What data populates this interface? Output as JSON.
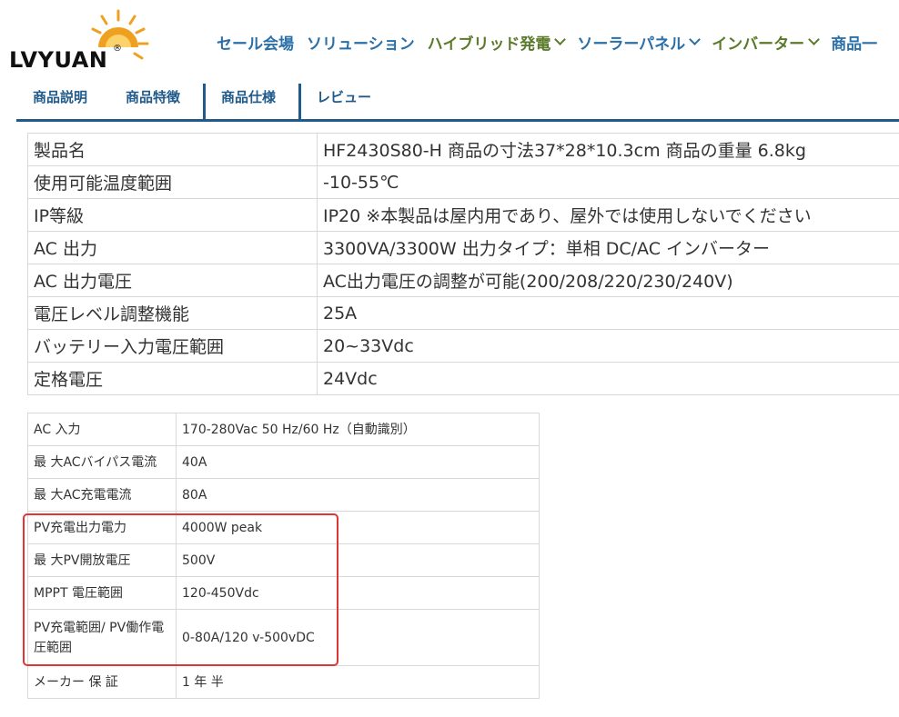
{
  "brand": {
    "name": "LVYUAN",
    "reg_mark": "®"
  },
  "nav": [
    {
      "label": "セール会場",
      "color": "#2a6fa8",
      "dropdown": false
    },
    {
      "label": "ソリューション",
      "color": "#2a6fa8",
      "dropdown": false
    },
    {
      "label": "ハイブリッド発電",
      "color": "#5a7a2a",
      "dropdown": true
    },
    {
      "label": "ソーラーパネル",
      "color": "#2a6fa8",
      "dropdown": true
    },
    {
      "label": "インバーター",
      "color": "#5a7a2a",
      "dropdown": true
    },
    {
      "label": "商品一",
      "color": "#2a6fa8",
      "dropdown": false
    }
  ],
  "tabs": [
    "商品説明",
    "商品特徴",
    "商品仕様",
    "レビュー"
  ],
  "spec_main": [
    {
      "key": "製品名",
      "value": "HF2430S80-H 商品の寸法37*28*10.3cm 商品の重量 6.8kg"
    },
    {
      "key": "使用可能温度範囲",
      "value": "-10-55℃"
    },
    {
      "key": "IP等級",
      "value": "IP20 ※本製品は屋内用であり、屋外では使用しないでください"
    },
    {
      "key": "AC 出力",
      "value": "3300VA/3300W 出力タイプ：単相 DC/AC インバーター"
    },
    {
      "key": "AC 出力電圧",
      "value": "AC出力電圧の調整が可能(200/208/220/230/240V)"
    },
    {
      "key": "電圧レベル調整機能",
      "value": "25A"
    },
    {
      "key": "バッテリー入力電圧範囲",
      "value": "20~33Vdc"
    },
    {
      "key": "定格電圧",
      "value": "24Vdc"
    }
  ],
  "spec_sub": [
    {
      "key": "AC 入力",
      "value": "170-280Vac 50 Hz/60 Hz（自動識別）"
    },
    {
      "key": "最 大ACバイパス電流",
      "value": "40A"
    },
    {
      "key": "最 大AC充電電流",
      "value": "80A"
    },
    {
      "key": "PV充電出力電力",
      "value": "4000W peak"
    },
    {
      "key": "最 大PV開放電圧",
      "value": "500V"
    },
    {
      "key": "MPPT 電圧範囲",
      "value": "120-450Vdc"
    },
    {
      "key": "PV充電範囲/ PV働作電圧範囲",
      "value": "0-80A/120 v-500vDC"
    },
    {
      "key": "メーカー 保 証",
      "value": "1 年 半"
    }
  ],
  "colors": {
    "accent_blue": "#1f5a8a",
    "nav_blue": "#2a6fa8",
    "nav_green": "#5a7a2a",
    "highlight_red": "#e03535",
    "sun_orange": "#f0a020"
  }
}
